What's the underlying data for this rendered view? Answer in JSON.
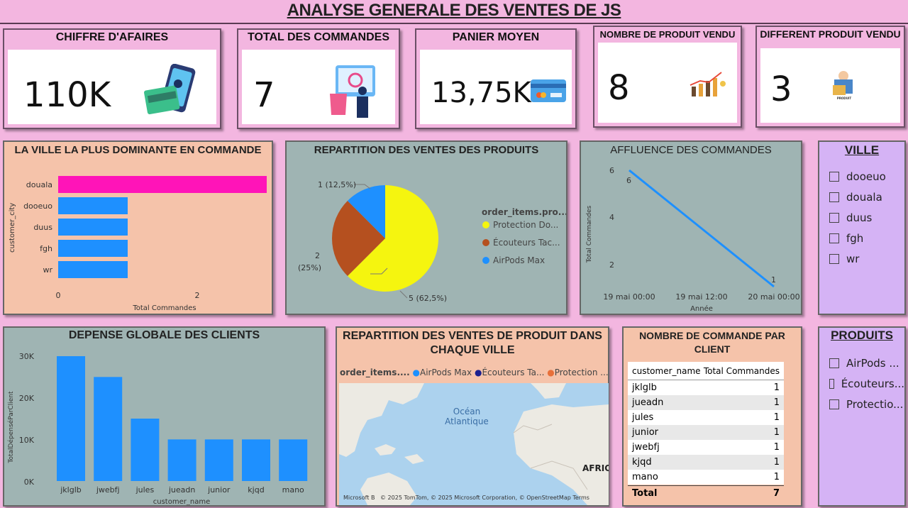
{
  "header": {
    "title": "ANALYSE GENERALE DES VENTES DE JS"
  },
  "kpis": [
    {
      "title": "CHIFFRE D'AFAIRES",
      "value": "110K"
    },
    {
      "title": "TOTAL DES COMMANDES",
      "value": "7"
    },
    {
      "title": "PANIER MOYEN",
      "value": "13,75K"
    },
    {
      "title": "NOMBRE DE PRODUIT VENDU",
      "value": "8"
    },
    {
      "title": "DIFFERENT PRODUIT VENDU",
      "value": "3",
      "icon_caption": "PRODUIT"
    }
  ],
  "city_chart": {
    "title": "LA VILLE LA PLUS DOMINANTE EN COMMANDE",
    "ylabel": "customer_city",
    "xlabel": "Total Commandes",
    "ticks": [
      "0",
      "2"
    ]
  },
  "pie_panel": {
    "title": "REPARTITION DES VENTES DES PRODUITS",
    "legend_title": "order_items.pro...",
    "legend": [
      "Protection Do...",
      "Écouteurs Tac...",
      "AirPods Max"
    ],
    "labels": [
      "5 (62,5%)",
      "2",
      "(25%)",
      "1 (12,5%)"
    ]
  },
  "line_panel": {
    "title": "AFFLUENCE DES COMMANDES",
    "ylabel": "Total Commandes",
    "xlabel": "Année",
    "yticks": [
      "6",
      "4",
      "2"
    ],
    "xticks": [
      "19 mai 00:00",
      "19 mai 12:00",
      "20 mai 00:00"
    ],
    "point_labels": [
      "6",
      "1"
    ]
  },
  "spend_panel": {
    "title": "DEPENSE GLOBALE DES CLIENTS",
    "ylabel": "TotalDépenséParClient",
    "xlabel": "customer_name",
    "yticks": [
      "30K",
      "20K",
      "10K",
      "0K"
    ]
  },
  "map_panel": {
    "title": "REPARTITION DES VENTES DE PRODUIT DANS CHAQUE VILLE",
    "legend_title": "order_items....",
    "legend": [
      "AirPods Max",
      "Écouteurs Ta...",
      "Protection ..."
    ],
    "ocean_label_1": "Océan",
    "ocean_label_2": "Atlantique",
    "continent_label": "AFRIQU",
    "copyright": "© 2025 TomTom, © 2025 Microsoft Corporation, © OpenStreetMap  Terms",
    "logo": "Microsoft B"
  },
  "orders_table": {
    "title": "NOMBRE DE COMMANDE PAR CLIENT",
    "col1": "customer_name",
    "col2": "Total Commandes",
    "rows": [
      {
        "name": "jklglb",
        "value": "1"
      },
      {
        "name": "jueadn",
        "value": "1"
      },
      {
        "name": "jules",
        "value": "1"
      },
      {
        "name": "junior",
        "value": "1"
      },
      {
        "name": "jwebfj",
        "value": "1"
      },
      {
        "name": "kjqd",
        "value": "1"
      },
      {
        "name": "mano",
        "value": "1"
      }
    ],
    "total_label": "Total",
    "total_value": "7"
  },
  "slicer_ville": {
    "title": "VILLE",
    "items": [
      "dooeuo",
      "douala",
      "duus",
      "fgh",
      "wr"
    ]
  },
  "slicer_produits": {
    "title": "PRODUITS",
    "items": [
      "AirPods ...",
      "Écouteurs...",
      "Protectio..."
    ]
  },
  "chart_data": [
    {
      "type": "bar",
      "title": "LA VILLE LA PLUS DOMINANTE EN COMMANDE",
      "orientation": "horizontal",
      "categories": [
        "douala",
        "dooeuo",
        "duus",
        "fgh",
        "wr"
      ],
      "values": [
        3,
        1,
        1,
        1,
        1
      ],
      "xlabel": "Total Commandes",
      "ylabel": "customer_city",
      "xlim": [
        0,
        3
      ],
      "colors": [
        "#ff14b8",
        "#1e90ff",
        "#1e90ff",
        "#1e90ff",
        "#1e90ff"
      ]
    },
    {
      "type": "pie",
      "title": "REPARTITION DES VENTES DES PRODUITS",
      "categories": [
        "Protection Do...",
        "Écouteurs Tac...",
        "AirPods Max"
      ],
      "values": [
        5,
        2,
        1
      ],
      "colors": [
        "#f5f50f",
        "#b5501f",
        "#1e90ff"
      ]
    },
    {
      "type": "line",
      "title": "AFFLUENCE DES COMMANDES",
      "x": [
        "19 mai 00:00",
        "20 mai 00:00"
      ],
      "y": [
        6,
        1
      ],
      "ylabel": "Total Commandes",
      "xlabel": "Année",
      "ylim": [
        1,
        6
      ],
      "color": "#1e90ff"
    },
    {
      "type": "bar",
      "title": "DEPENSE GLOBALE DES CLIENTS",
      "categories": [
        "jklglb",
        "jwebfj",
        "jules",
        "jueadn",
        "junior",
        "kjqd",
        "mano"
      ],
      "values": [
        30000,
        25000,
        15000,
        10000,
        10000,
        10000,
        10000
      ],
      "xlabel": "customer_name",
      "ylabel": "TotalDépenséParClient",
      "ylim": [
        0,
        30000
      ],
      "color": "#1e90ff"
    }
  ]
}
